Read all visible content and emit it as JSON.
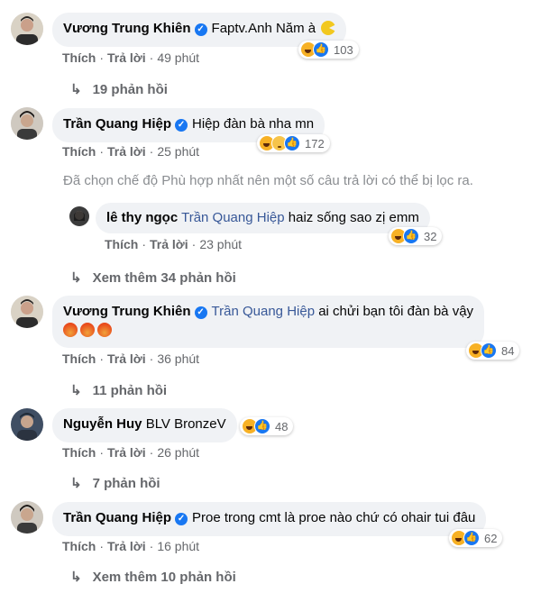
{
  "comments": [
    {
      "author": "Vương Trung Khiên",
      "text": "Faptv.Anh Năm à",
      "emoji": "pacman",
      "actions": {
        "like": "Thích",
        "reply": "Trả lời",
        "time": "49 phút"
      },
      "reaction_count": "103",
      "replies_label": "19 phản hồi"
    },
    {
      "author": "Trần Quang Hiệp",
      "text": "Hiệp đàn bà nha mn",
      "actions": {
        "like": "Thích",
        "reply": "Trả lời",
        "time": "25 phút"
      },
      "reaction_count": "172",
      "filter_notice": "Đã chọn chế độ Phù hợp nhất nên một số câu trả lời có thể bị lọc ra.",
      "reply": {
        "author": "lê thy ngọc",
        "tag": "Trần Quang Hiệp",
        "text": "haiz sống sao zị emm",
        "actions": {
          "like": "Thích",
          "reply": "Trả lời",
          "time": "23 phút"
        },
        "reaction_count": "32"
      },
      "replies_label": "Xem thêm 34 phản hồi"
    },
    {
      "author": "Vương Trung Khiên",
      "tag": "Trần Quang Hiệp",
      "text": "ai chửi bạn tôi đàn bà vậy",
      "extra_emojis": [
        "angry-face",
        "angry-face",
        "angry-face"
      ],
      "actions": {
        "like": "Thích",
        "reply": "Trả lời",
        "time": "36 phút"
      },
      "reaction_count": "84",
      "replies_label": "11 phản hồi"
    },
    {
      "author": "Nguyễn Huy",
      "text": "BLV BronzeV",
      "actions": {
        "like": "Thích",
        "reply": "Trả lời",
        "time": "26 phút"
      },
      "reaction_count": "48",
      "replies_label": "7 phản hồi"
    },
    {
      "author": "Trần Quang Hiệp",
      "text": "Proe trong cmt là proe nào chứ có ohair tui đâu",
      "actions": {
        "like": "Thích",
        "reply": "Trả lời",
        "time": "16 phút"
      },
      "reaction_count": "62",
      "replies_label": "Xem thêm 10 phản hồi"
    }
  ],
  "separator": "·",
  "reply_arrow": "↳",
  "verified_glyph": "✓",
  "colors": {
    "bubble": "#f0f2f5",
    "secondary_text": "#65676b",
    "verified": "#1877f2",
    "link": "#385898"
  }
}
